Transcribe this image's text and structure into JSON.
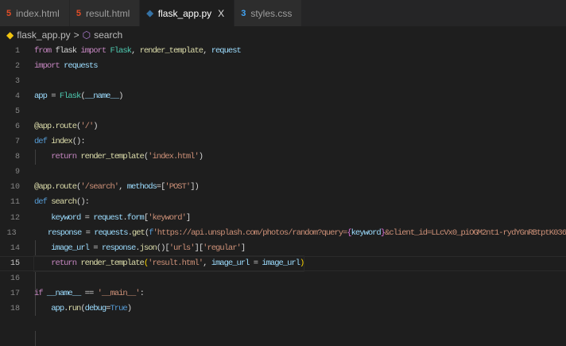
{
  "tabs": [
    {
      "label": "index.html",
      "icon": "html5-icon",
      "color": "#e44d26"
    },
    {
      "label": "result.html",
      "icon": "html5-icon",
      "color": "#e44d26"
    },
    {
      "label": "flask_app.py",
      "icon": "python-icon",
      "color": "#3572a5",
      "active": true,
      "close": "X"
    },
    {
      "label": "styles.css",
      "icon": "css3-icon",
      "color": "#42a5f5"
    }
  ],
  "breadcrumb": {
    "file": "flask_app.py",
    "separator": ">",
    "symbol": "search"
  },
  "current_line": 15,
  "lines": [
    {
      "n": "1",
      "t": [
        [
          "from",
          "k"
        ],
        [
          " flask ",
          "p"
        ],
        [
          "import",
          "k"
        ],
        [
          " ",
          "p"
        ],
        [
          "Flask",
          "c"
        ],
        [
          ", ",
          "p"
        ],
        [
          "render_template",
          "f"
        ],
        [
          ", ",
          "p"
        ],
        [
          "request",
          "v"
        ]
      ]
    },
    {
      "n": "2",
      "t": [
        [
          "import",
          "k"
        ],
        [
          " ",
          "p"
        ],
        [
          "requests",
          "v"
        ]
      ]
    },
    {
      "n": "3",
      "t": []
    },
    {
      "n": "4",
      "t": [
        [
          "app",
          "v"
        ],
        [
          " = ",
          "p"
        ],
        [
          "Flask",
          "c"
        ],
        [
          "(",
          "p"
        ],
        [
          "__name__",
          "v"
        ],
        [
          ")",
          "p"
        ]
      ]
    },
    {
      "n": "5",
      "t": []
    },
    {
      "n": "6",
      "t": [
        [
          "@",
          "f"
        ],
        [
          "app",
          "f"
        ],
        [
          ".",
          "f"
        ],
        [
          "route",
          "f"
        ],
        [
          "(",
          "p"
        ],
        [
          "'/'",
          "s"
        ],
        [
          ")",
          "p"
        ]
      ]
    },
    {
      "n": "7",
      "t": [
        [
          "def",
          "b"
        ],
        [
          " ",
          "p"
        ],
        [
          "index",
          "f"
        ],
        [
          "():",
          "p"
        ]
      ]
    },
    {
      "n": "8",
      "t": [
        [
          "    ",
          "p"
        ],
        [
          "return",
          "k"
        ],
        [
          " ",
          "p"
        ],
        [
          "render_template",
          "f"
        ],
        [
          "(",
          "p"
        ],
        [
          "'index.html'",
          "s"
        ],
        [
          ")",
          "p"
        ]
      ]
    },
    {
      "n": "9",
      "t": []
    },
    {
      "n": "10",
      "t": [
        [
          "@",
          "f"
        ],
        [
          "app",
          "f"
        ],
        [
          ".",
          "f"
        ],
        [
          "route",
          "f"
        ],
        [
          "(",
          "p"
        ],
        [
          "'/search'",
          "s"
        ],
        [
          ", ",
          "p"
        ],
        [
          "methods",
          "v"
        ],
        [
          "=[",
          "p"
        ],
        [
          "'POST'",
          "s"
        ],
        [
          "])",
          "p"
        ]
      ]
    },
    {
      "n": "11",
      "t": [
        [
          "def",
          "b"
        ],
        [
          " ",
          "p"
        ],
        [
          "search",
          "f"
        ],
        [
          "():",
          "p"
        ]
      ]
    },
    {
      "n": "12",
      "t": [
        [
          "    ",
          "p"
        ],
        [
          "keyword",
          "v"
        ],
        [
          " = ",
          "p"
        ],
        [
          "request",
          "v"
        ],
        [
          ".",
          "p"
        ],
        [
          "form",
          "v"
        ],
        [
          "[",
          "p"
        ],
        [
          "'keyword'",
          "s"
        ],
        [
          "]",
          "p"
        ]
      ]
    },
    {
      "n": "13",
      "t": [
        [
          "    ",
          "p"
        ],
        [
          "response",
          "v"
        ],
        [
          " = ",
          "p"
        ],
        [
          "requests",
          "v"
        ],
        [
          ".",
          "p"
        ],
        [
          "get",
          "f"
        ],
        [
          "(",
          "p"
        ],
        [
          "f",
          "b"
        ],
        [
          "'https://api.unsplash.com/photos/random?query=",
          "s"
        ],
        [
          "{",
          "m"
        ],
        [
          "keyword",
          "v"
        ],
        [
          "}",
          "m"
        ],
        [
          "&client_id=LLcVx0_piOGM2nt1-rydYGnRBtptK036",
          "s"
        ]
      ]
    },
    {
      "n": "14",
      "t": [
        [
          "    ",
          "p"
        ],
        [
          "image_url",
          "v"
        ],
        [
          " = ",
          "p"
        ],
        [
          "response",
          "v"
        ],
        [
          ".",
          "p"
        ],
        [
          "json",
          "f"
        ],
        [
          "()[",
          "p"
        ],
        [
          "'urls'",
          "s"
        ],
        [
          "][",
          "p"
        ],
        [
          "'regular'",
          "s"
        ],
        [
          "]",
          "p"
        ]
      ]
    },
    {
      "n": "15",
      "t": [
        [
          "    ",
          "p"
        ],
        [
          "return",
          "k"
        ],
        [
          " ",
          "p"
        ],
        [
          "render_template",
          "f"
        ],
        [
          "(",
          "y"
        ],
        [
          "'result.html'",
          "s"
        ],
        [
          ", ",
          "p"
        ],
        [
          "image_url",
          "v"
        ],
        [
          " = ",
          "p"
        ],
        [
          "image_url",
          "v"
        ],
        [
          ")",
          "y"
        ]
      ]
    },
    {
      "n": "16",
      "t": []
    },
    {
      "n": "17",
      "t": [
        [
          "if",
          "k"
        ],
        [
          " ",
          "p"
        ],
        [
          "__name__",
          "v"
        ],
        [
          " == ",
          "p"
        ],
        [
          "'__main__'",
          "s"
        ],
        [
          ":",
          "p"
        ]
      ]
    },
    {
      "n": "18",
      "t": [
        [
          "    ",
          "p"
        ],
        [
          "app",
          "v"
        ],
        [
          ".",
          "p"
        ],
        [
          "run",
          "f"
        ],
        [
          "(",
          "p"
        ],
        [
          "debug",
          "v"
        ],
        [
          "=",
          "p"
        ],
        [
          "True",
          "b"
        ],
        [
          ")",
          "p"
        ]
      ]
    }
  ]
}
